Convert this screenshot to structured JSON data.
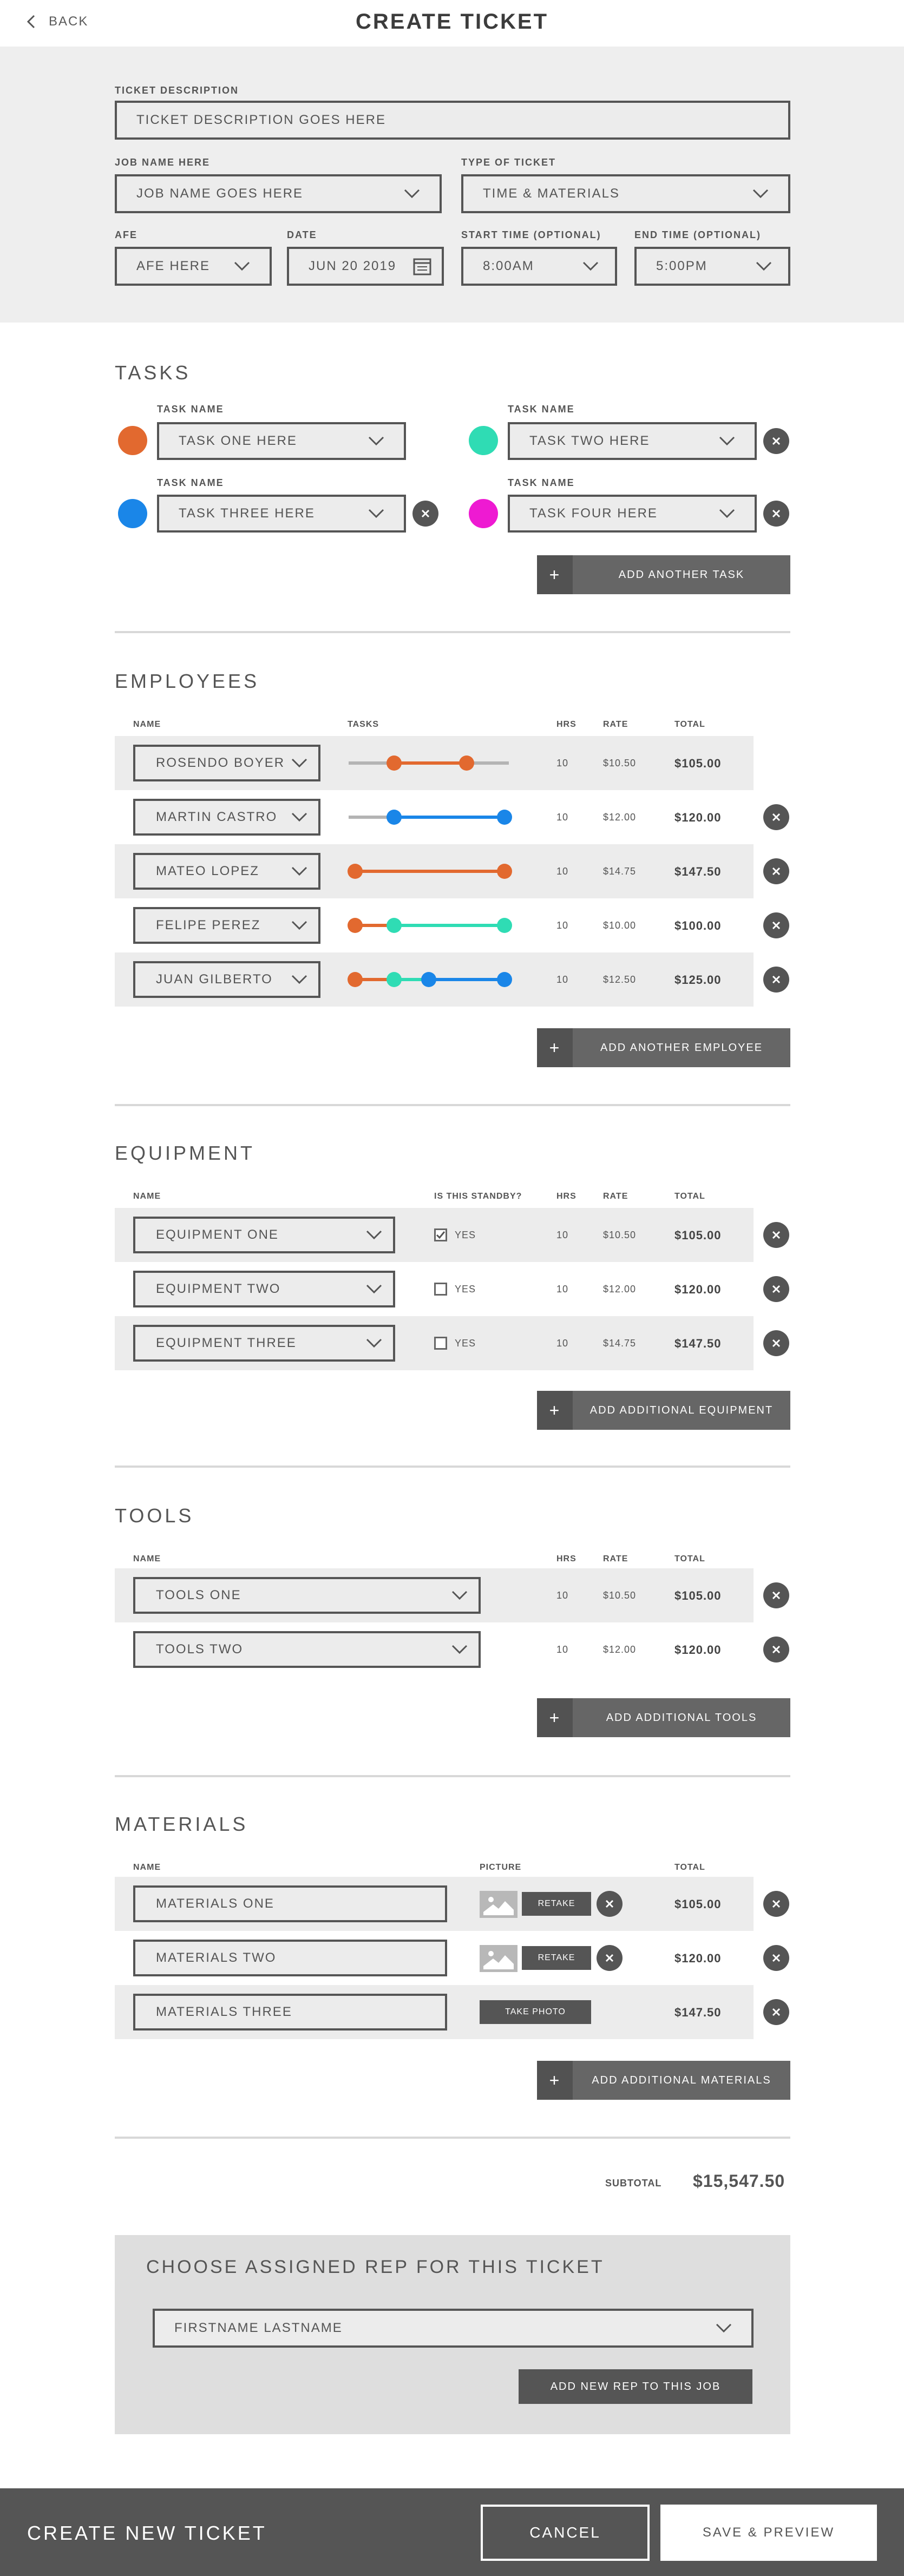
{
  "header": {
    "back_label": "BACK",
    "title": "CREATE TICKET"
  },
  "ticket": {
    "description_label": "TICKET DESCRIPTION",
    "description_placeholder": "TICKET DESCRIPTION GOES HERE",
    "job_label": "JOB NAME HERE",
    "job_value": "JOB NAME GOES HERE",
    "type_label": "TYPE OF TICKET",
    "type_value": "TIME & MATERIALS",
    "afe_label": "AFE",
    "afe_value": "AFE HERE",
    "date_label": "DATE",
    "date_value": "JUN 20 2019",
    "start_label": "START TIME (OPTIONAL)",
    "start_value": "8:00AM",
    "end_label": "END TIME (OPTIONAL)",
    "end_value": "5:00PM"
  },
  "colors": {
    "orange": "#e2692f",
    "teal": "#2fdcb4",
    "blue": "#1a86e8",
    "magenta": "#ee1ad2",
    "gray": "#b4b4b4"
  },
  "tasks": {
    "heading": "TASKS",
    "task_label": "TASK NAME",
    "add_label": "ADD ANOTHER TASK",
    "items": [
      {
        "name": "TASK ONE HERE",
        "color": "orange"
      },
      {
        "name": "TASK TWO HERE",
        "color": "teal"
      },
      {
        "name": "TASK THREE HERE",
        "color": "blue"
      },
      {
        "name": "TASK FOUR HERE",
        "color": "magenta"
      }
    ]
  },
  "employees": {
    "heading": "EMPLOYEES",
    "columns": {
      "name": "NAME",
      "tasks": "TASKS",
      "hrs": "HRS",
      "rate": "RATE",
      "total": "TOTAL"
    },
    "rows": [
      {
        "name": "ROSENDO BOYER",
        "hrs": "10",
        "rate": "$10.50",
        "total": "$105.00"
      },
      {
        "name": "MARTIN CASTRO",
        "hrs": "10",
        "rate": "$12.00",
        "total": "$120.00"
      },
      {
        "name": "MATEO LOPEZ",
        "hrs": "10",
        "rate": "$14.75",
        "total": "$147.50"
      },
      {
        "name": "FELIPE PEREZ",
        "hrs": "10",
        "rate": "$10.00",
        "total": "$100.00"
      },
      {
        "name": "JUAN GILBERTO",
        "hrs": "10",
        "rate": "$12.50",
        "total": "$125.00"
      }
    ],
    "add_label": "ADD ANOTHER EMPLOYEE"
  },
  "equipment": {
    "heading": "EQUIPMENT",
    "columns": {
      "name": "NAME",
      "standby": "IS THIS STANDBY?",
      "hrs": "HRS",
      "rate": "RATE",
      "total": "TOTAL"
    },
    "rows": [
      {
        "name": "EQUIPMENT ONE",
        "standby_label": "YES",
        "standby_checked": true,
        "hrs": "10",
        "rate": "$10.50",
        "total": "$105.00"
      },
      {
        "name": "EQUIPMENT TWO",
        "standby_label": "YES",
        "standby_checked": false,
        "hrs": "10",
        "rate": "$12.00",
        "total": "$120.00"
      },
      {
        "name": "EQUIPMENT THREE",
        "standby_label": "YES",
        "standby_checked": false,
        "hrs": "10",
        "rate": "$14.75",
        "total": "$147.50"
      }
    ],
    "add_label": "ADD ADDITIONAL EQUIPMENT"
  },
  "tools": {
    "heading": "TOOLS",
    "columns": {
      "name": "NAME",
      "hrs": "HRS",
      "rate": "RATE",
      "total": "TOTAL"
    },
    "rows": [
      {
        "name": "TOOLS ONE",
        "hrs": "10",
        "rate": "$10.50",
        "total": "$105.00"
      },
      {
        "name": "TOOLS TWO",
        "hrs": "10",
        "rate": "$12.00",
        "total": "$120.00"
      }
    ],
    "add_label": "ADD ADDITIONAL TOOLS"
  },
  "materials": {
    "heading": "MATERIALS",
    "columns": {
      "name": "NAME",
      "picture": "PICTURE",
      "total": "TOTAL"
    },
    "rows": [
      {
        "name": "MATERIALS ONE",
        "photo_action": "RETAKE",
        "total": "$105.00"
      },
      {
        "name": "MATERIALS TWO",
        "photo_action": "RETAKE",
        "total": "$120.00"
      },
      {
        "name": "MATERIALS THREE",
        "photo_action": "TAKE PHOTO",
        "total": "$147.50"
      }
    ],
    "add_label": "ADD ADDITIONAL MATERIALS"
  },
  "subtotal": {
    "label": "SUBTOTAL",
    "value": "$15,547.50"
  },
  "rep": {
    "heading": "CHOOSE ASSIGNED REP FOR THIS TICKET",
    "value": "FIRSTNAME LASTNAME",
    "add_label": "ADD NEW REP TO THIS JOB"
  },
  "footer": {
    "title": "CREATE NEW TICKET",
    "cancel_label": "CANCEL",
    "save_label": "SAVE & PREVIEW"
  }
}
